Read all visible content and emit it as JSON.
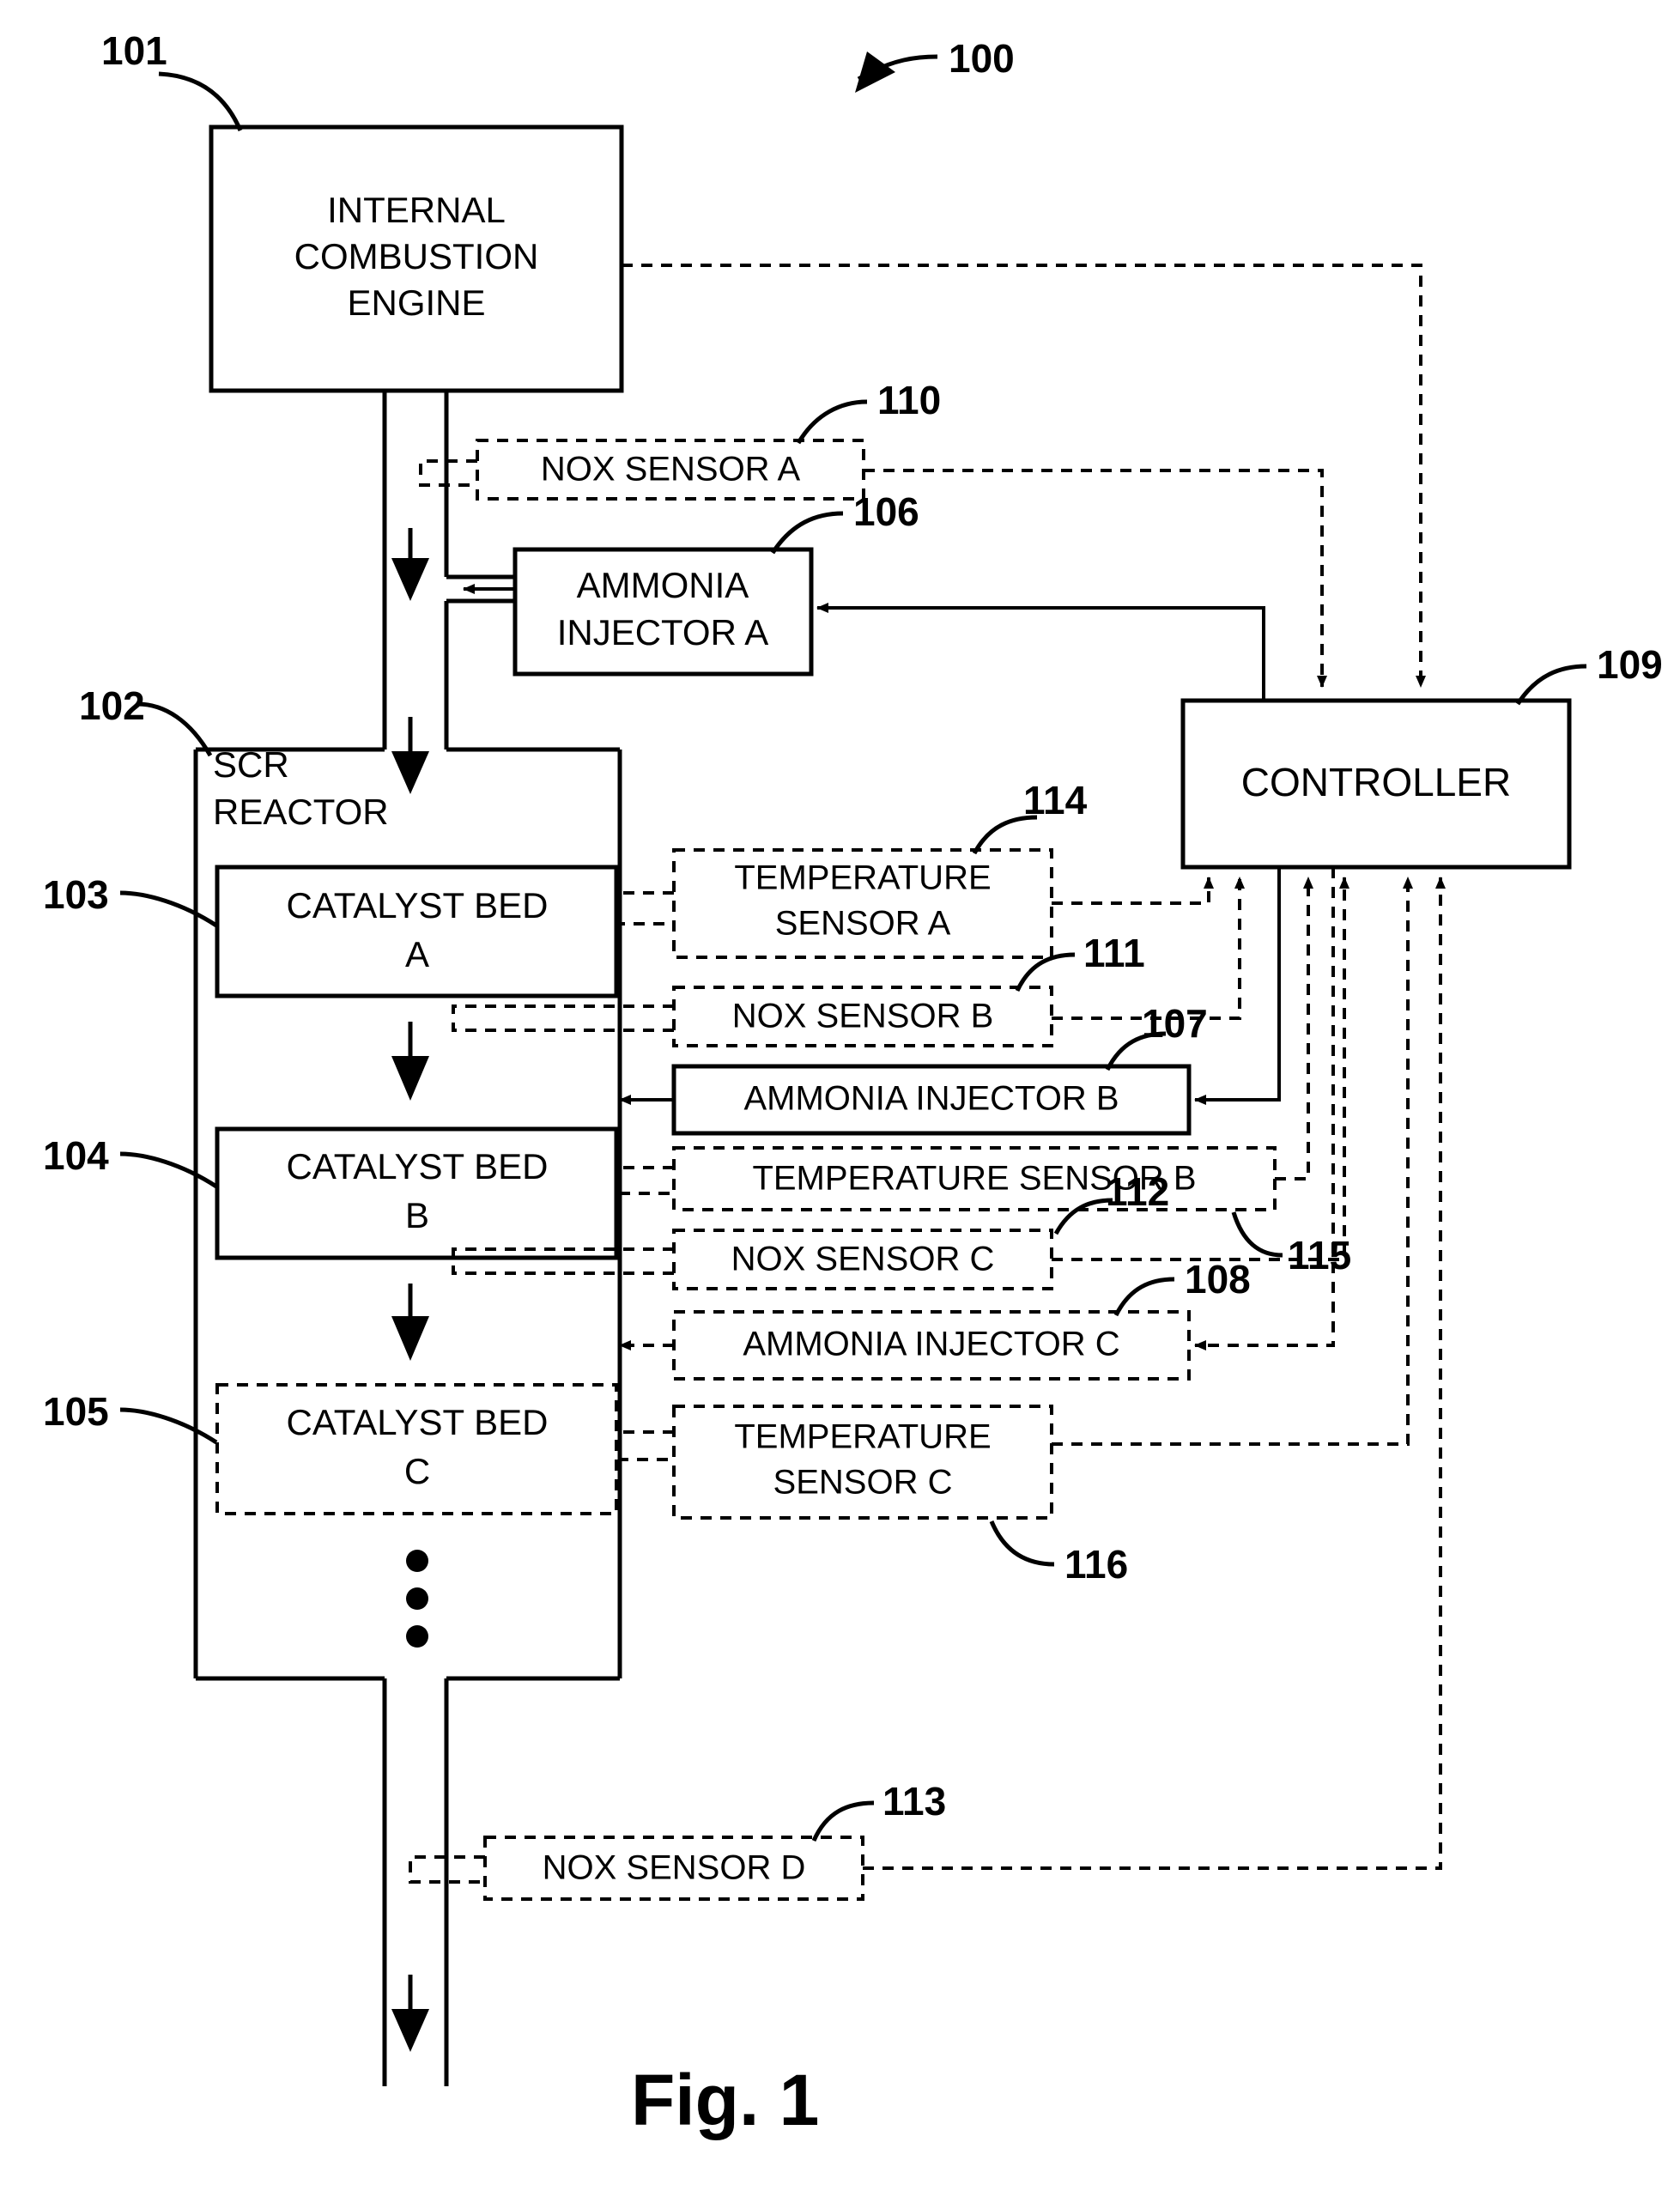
{
  "figure": {
    "caption": "Fig. 1",
    "system_ref": "100"
  },
  "blocks": {
    "engine": {
      "label_line1": "INTERNAL",
      "label_line2": "COMBUSTION",
      "label_line3": "ENGINE",
      "ref": "101",
      "style": "solid"
    },
    "scr_reactor": {
      "label_line1": "SCR",
      "label_line2": "REACTOR",
      "ref": "102",
      "style": "solid"
    },
    "catalyst_bed_a": {
      "label_line1": "CATALYST BED",
      "label_line2": "A",
      "ref": "103",
      "style": "solid"
    },
    "catalyst_bed_b": {
      "label_line1": "CATALYST BED",
      "label_line2": "B",
      "ref": "104",
      "style": "solid"
    },
    "catalyst_bed_c": {
      "label_line1": "CATALYST BED",
      "label_line2": "C",
      "ref": "105",
      "style": "dashed"
    },
    "ammonia_injector_a": {
      "label_line1": "AMMONIA",
      "label_line2": "INJECTOR A",
      "ref": "106",
      "style": "solid"
    },
    "ammonia_injector_b": {
      "label_line1": "AMMONIA INJECTOR B",
      "ref": "107",
      "style": "solid"
    },
    "ammonia_injector_c": {
      "label_line1": "AMMONIA INJECTOR C",
      "ref": "108",
      "style": "dashed"
    },
    "controller": {
      "label_line1": "CONTROLLER",
      "ref": "109",
      "style": "solid"
    },
    "nox_sensor_a": {
      "label_line1": "NOX SENSOR A",
      "ref": "110",
      "style": "dashed"
    },
    "nox_sensor_b": {
      "label_line1": "NOX SENSOR B",
      "ref": "111",
      "style": "dashed"
    },
    "nox_sensor_c": {
      "label_line1": "NOX SENSOR C",
      "ref": "112",
      "style": "dashed"
    },
    "nox_sensor_d": {
      "label_line1": "NOX SENSOR D",
      "ref": "113",
      "style": "dashed"
    },
    "temperature_sensor_a": {
      "label_line1": "TEMPERATURE",
      "label_line2": "SENSOR A",
      "ref": "114",
      "style": "dashed"
    },
    "temperature_sensor_b": {
      "label_line1": "TEMPERATURE SENSOR B",
      "ref": "115",
      "style": "dashed"
    },
    "temperature_sensor_c": {
      "label_line1": "TEMPERATURE",
      "label_line2": "SENSOR C",
      "ref": "116",
      "style": "dashed"
    }
  },
  "annotations": {
    "vertical_ellipsis": "•••"
  },
  "colors": {
    "ink": "#000000",
    "background": "#ffffff"
  }
}
